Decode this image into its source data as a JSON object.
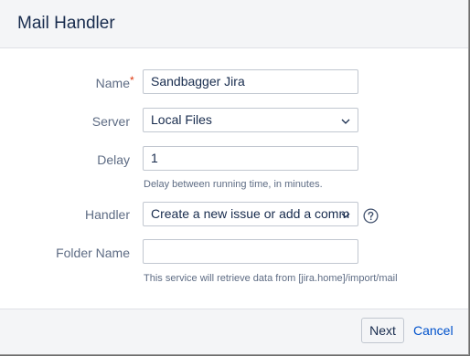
{
  "dialog": {
    "title": "Mail Handler"
  },
  "form": {
    "name": {
      "label": "Name",
      "required_marker": "*",
      "value": "Sandbagger Jira"
    },
    "server": {
      "label": "Server",
      "selected": "Local Files"
    },
    "delay": {
      "label": "Delay",
      "value": "1",
      "description": "Delay between running time, in minutes."
    },
    "handler": {
      "label": "Handler",
      "selected": "Create a new issue or add a comm",
      "help_icon": "help-icon"
    },
    "folder_name": {
      "label": "Folder Name",
      "value": "",
      "description": "This service will retrieve data from [jira.home]/import/mail"
    }
  },
  "footer": {
    "next_label": "Next",
    "cancel_label": "Cancel"
  },
  "colors": {
    "accent": "#0052cc",
    "required": "#de350b",
    "label": "#5e6c84"
  }
}
